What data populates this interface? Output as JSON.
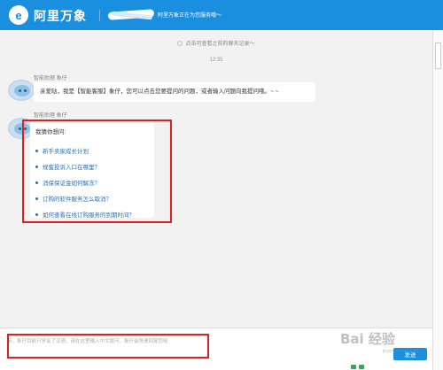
{
  "header": {
    "logo_glyph": "e",
    "title": "阿里万象",
    "status_text": "阿里万象正在为您服务哦～"
  },
  "chat": {
    "history_link": "点击可查看之前的聊天记录～",
    "timestamp": "12:35",
    "messages": [
      {
        "sender": "智能助理 象仔",
        "text": "亲爱哒，我是【智能客服】象仔，您可以点击您要提问的问题，或者输入问题向我提问哦。~ ~"
      },
      {
        "sender": "智能助理 象仔",
        "card_title": "我猜你想问:",
        "questions": [
          "新手卖家成长计划",
          "规蜜投诉入口在哪里？",
          "消保保证金如何解冻？",
          "订购的软件服务怎么取消？",
          "如何查看在线订购服务的到期时间？"
        ]
      }
    ]
  },
  "input": {
    "placeholder": "亲，象仔目前只学会了汉语，请在这里输入中文提问，象仔会快速回复您哒",
    "value": "",
    "send_label": "发送"
  },
  "watermark": {
    "text": "Bai 经验",
    "sub": "jingyan.baidu.com"
  },
  "colors": {
    "brand_blue": "#1a8fe0",
    "link_blue": "#2b6fb3",
    "annotation_red": "#e02020"
  },
  "icons": [
    "logo-icon",
    "history-icon",
    "avatar-icon",
    "emoji-icon",
    "image-icon"
  ]
}
